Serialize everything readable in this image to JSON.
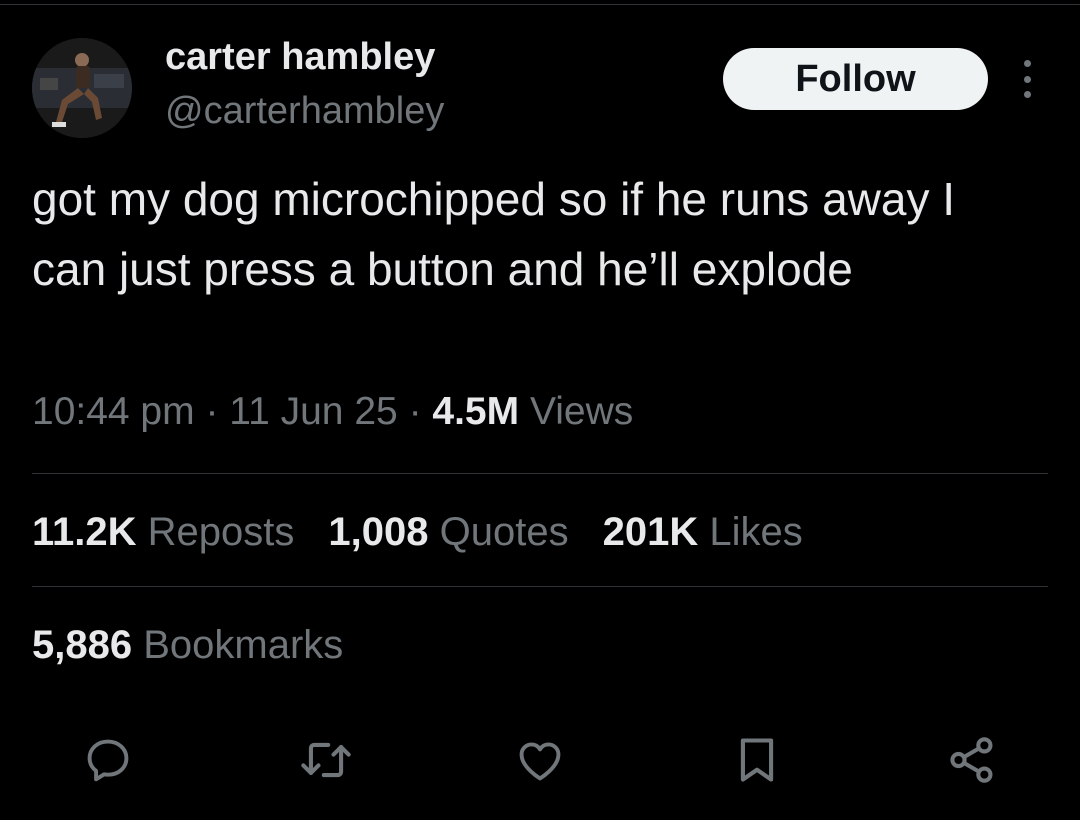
{
  "author": {
    "display_name": "carter hambley",
    "handle": "@carterhambley",
    "avatar_icon": "profile-photo"
  },
  "follow_label": "Follow",
  "more_icon": "more-vertical-icon",
  "tweet": {
    "text": "got my dog microchipped so if he runs away I can just press a button and he’ll explode",
    "time": "10:44 pm",
    "date": "11 Jun 25",
    "separator": "·",
    "views_count": "4.5M",
    "views_label": "Views"
  },
  "stats": {
    "reposts_count": "11.2K",
    "reposts_label": "Reposts",
    "quotes_count": "1,008",
    "quotes_label": "Quotes",
    "likes_count": "201K",
    "likes_label": "Likes",
    "bookmarks_count": "5,886",
    "bookmarks_label": "Bookmarks"
  },
  "actions": [
    "reply-icon",
    "repost-icon",
    "like-icon",
    "bookmark-icon",
    "share-icon"
  ],
  "colors": {
    "background": "#000000",
    "text_primary": "#e7e9ea",
    "text_secondary": "#71767b",
    "divider": "#2f3336",
    "follow_bg": "#eff3f4"
  }
}
